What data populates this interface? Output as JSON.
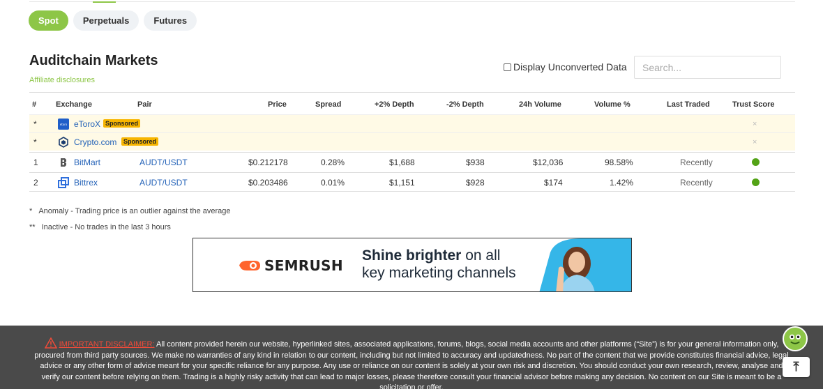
{
  "tabs": [
    "Spot",
    "Perpetuals",
    "Futures"
  ],
  "title": "Auditchain Markets",
  "affiliate": "Affiliate disclosures",
  "unconverted_label": "Display Unconverted Data",
  "search_placeholder": "Search...",
  "columns": [
    "#",
    "Exchange",
    "Pair",
    "Price",
    "Spread",
    "+2% Depth",
    "-2% Depth",
    "24h Volume",
    "Volume %",
    "Last Traded",
    "Trust Score"
  ],
  "sponsored_rows": [
    {
      "rank": "*",
      "exchange": "eToroX",
      "badge": "Sponsored",
      "mark": "×"
    },
    {
      "rank": "*",
      "exchange": "Crypto.com",
      "badge": "Sponsored",
      "mark": "×"
    }
  ],
  "rows": [
    {
      "rank": "1",
      "exchange": "BitMart",
      "pair": "AUDT/USDT",
      "price": "$0.212178",
      "spread": "0.28%",
      "depth_up": "$1,688",
      "depth_down": "$938",
      "volume": "$12,036",
      "volume_pct": "98.58%",
      "last_traded": "Recently",
      "trust": "green"
    },
    {
      "rank": "2",
      "exchange": "Bittrex",
      "pair": "AUDT/USDT",
      "price": "$0.203486",
      "spread": "0.01%",
      "depth_up": "$1,151",
      "depth_down": "$928",
      "volume": "$174",
      "volume_pct": "1.42%",
      "last_traded": "Recently",
      "trust": "green"
    }
  ],
  "legend": [
    {
      "mark": "*",
      "text": "Anomaly - Trading price is an outlier against the average"
    },
    {
      "mark": "**",
      "text": "Inactive - No trades in the last 3 hours"
    }
  ],
  "ad": {
    "brand": "SEMRUSH",
    "headline_bold": "Shine brighter",
    "headline_rest": " on all",
    "headline_line2": "key marketing channels"
  },
  "disclaimer": {
    "label": "IMPORTANT DISCLAIMER:",
    "text": " All content provided herein our website, hyperlinked sites, associated applications, forums, blogs, social media accounts and other platforms (“Site”) is for your general information only, procured from third party sources. We make no warranties of any kind in relation to our content, including but not limited to accuracy and updatedness. No part of the content that we provide constitutes financial advice, legal advice or any other form of advice meant for your specific reliance for any purpose. Any use or reliance on our content is solely at your own risk and discretion. You should conduct your own research, review, analyse and verify our content before relying on them. Trading is a highly risky activity that can lead to major losses, please therefore consult your financial advisor before making any decision. No content on our Site is meant to be a solicitation or offer."
  },
  "colors": {
    "accent": "#8dc647",
    "link": "#2563b8",
    "sponsored_bg": "#fffae6",
    "badge": "#f7b500",
    "footer": "#4a4a4a",
    "trust_green": "#53a317"
  }
}
